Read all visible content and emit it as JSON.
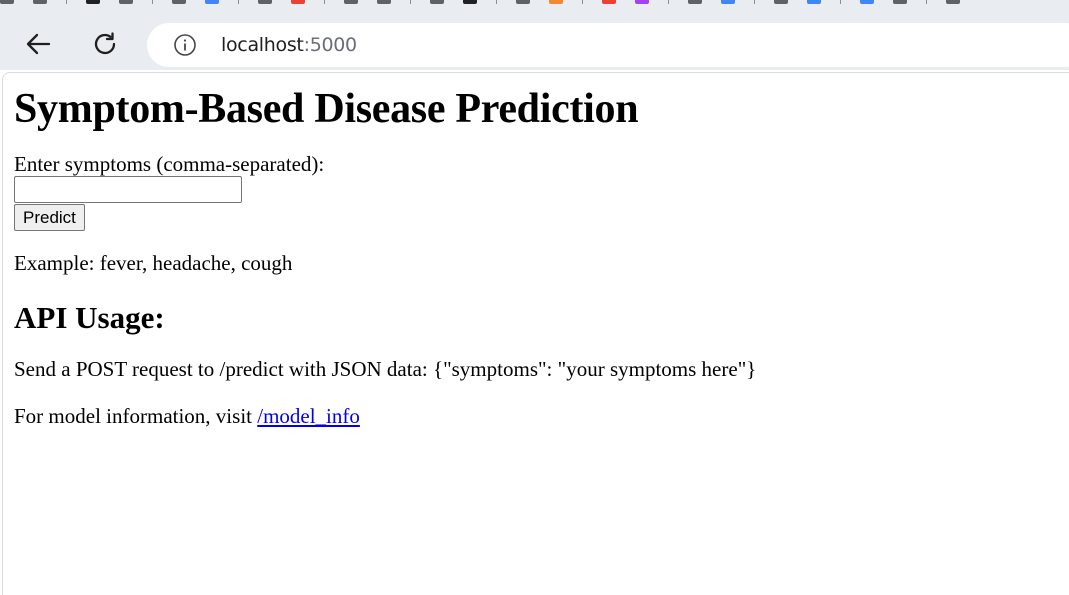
{
  "browser": {
    "url_host": "localhost",
    "url_port": ":5000",
    "tab_favicon_colors": [
      "#5f6368",
      "#5f6368",
      "#202124",
      "#5f6368",
      "#5f6368",
      "#4285f4",
      "#5f6368",
      "#ea4335",
      "#5f6368",
      "#5f6368",
      "#5f6368",
      "#202124",
      "#5f6368",
      "#f28b30",
      "#ea4335",
      "#a142f4",
      "#5f6368",
      "#4285f4",
      "#5f6368",
      "#4285f4",
      "#4285f4",
      "#5f6368",
      "#5f6368"
    ]
  },
  "page": {
    "title": "Symptom-Based Disease Prediction",
    "form": {
      "label": "Enter symptoms (comma-separated):",
      "input_value": "",
      "submit_label": "Predict"
    },
    "example": "Example: fever, headache, cough",
    "api_heading": "API Usage:",
    "api_description": "Send a POST request to /predict with JSON data: {\"symptoms\": \"your symptoms here\"}",
    "model_info_prefix": "For model information, visit ",
    "model_info_link": "/model_info"
  },
  "colors": {
    "link": "#0000ee",
    "chrome_background": "#e9edf1"
  }
}
